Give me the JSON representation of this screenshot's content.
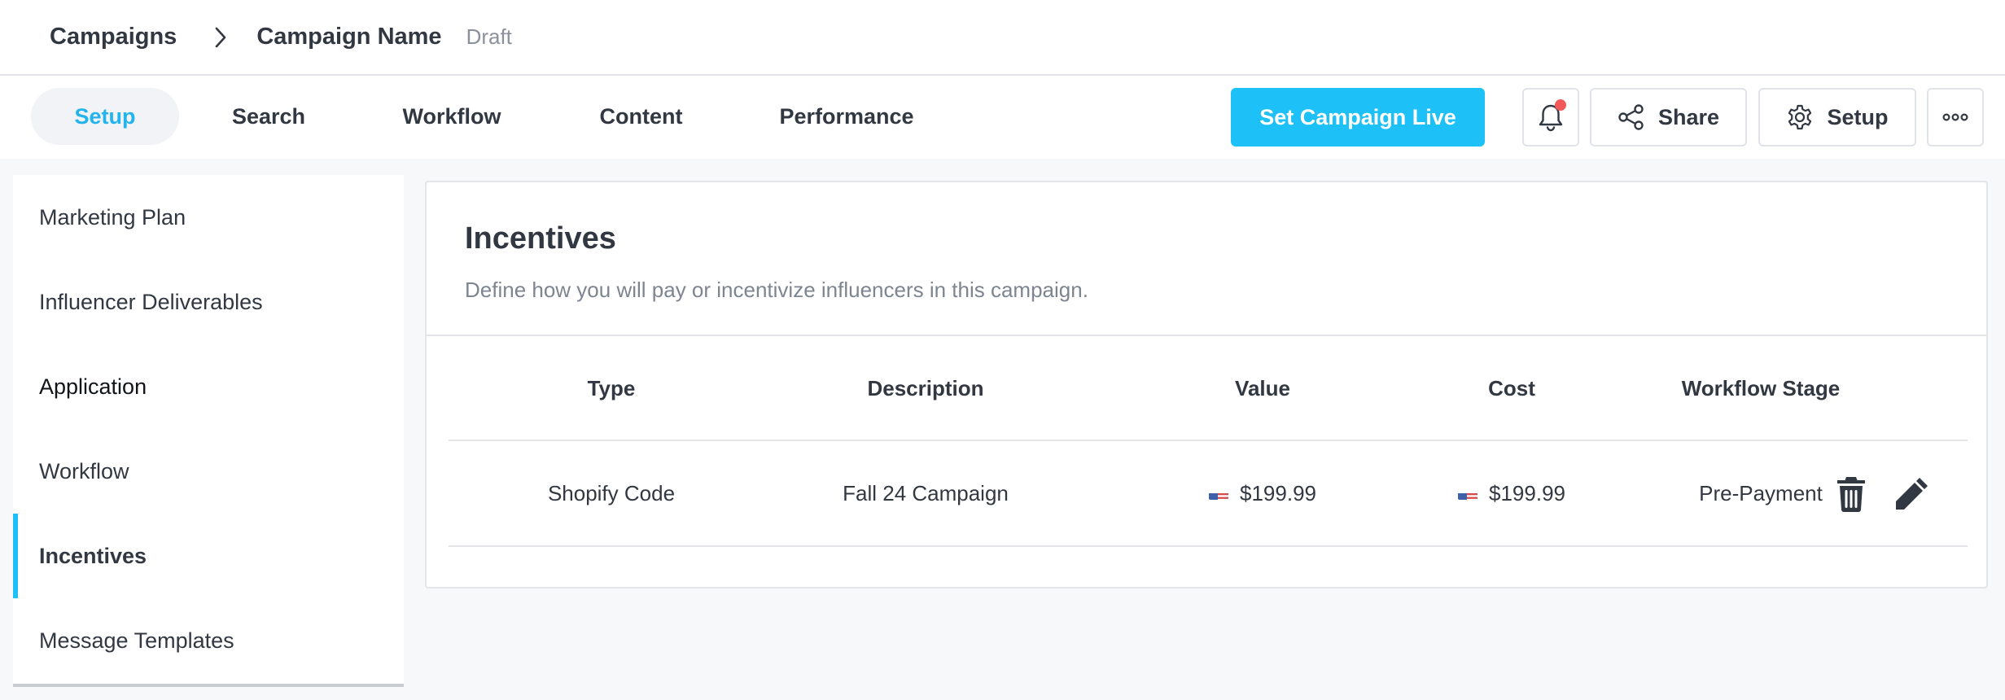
{
  "breadcrumb": {
    "root": "Campaigns",
    "current": "Campaign Name",
    "status": "Draft"
  },
  "tabs": [
    {
      "label": "Setup",
      "active": true
    },
    {
      "label": "Search",
      "active": false
    },
    {
      "label": "Workflow",
      "active": false
    },
    {
      "label": "Content",
      "active": false
    },
    {
      "label": "Performance",
      "active": false
    }
  ],
  "toolbar": {
    "go_live_label": "Set Campaign Live",
    "share_label": "Share",
    "setup_label": "Setup",
    "has_notification": true
  },
  "sidebar": {
    "items": [
      {
        "label": "Marketing Plan"
      },
      {
        "label": "Influencer Deliverables"
      },
      {
        "label": "Application"
      },
      {
        "label": "Workflow"
      },
      {
        "label": "Incentives",
        "active": true
      },
      {
        "label": "Message Templates"
      }
    ]
  },
  "incentives": {
    "title": "Incentives",
    "subtitle": "Define how you will pay or incentivize influencers in this campaign.",
    "columns": [
      "Type",
      "Description",
      "Value",
      "Cost",
      "Workflow Stage"
    ],
    "rows": [
      {
        "type": "Shopify Code",
        "description": "Fall 24 Campaign",
        "value": "$199.99",
        "cost": "$199.99",
        "stage": "Pre-Payment",
        "currency_flag": "us-flag-icon"
      }
    ]
  },
  "colors": {
    "accent": "#1ec1f7",
    "notification": "#f25a5a",
    "text": "#323842",
    "muted": "#7d8591"
  }
}
